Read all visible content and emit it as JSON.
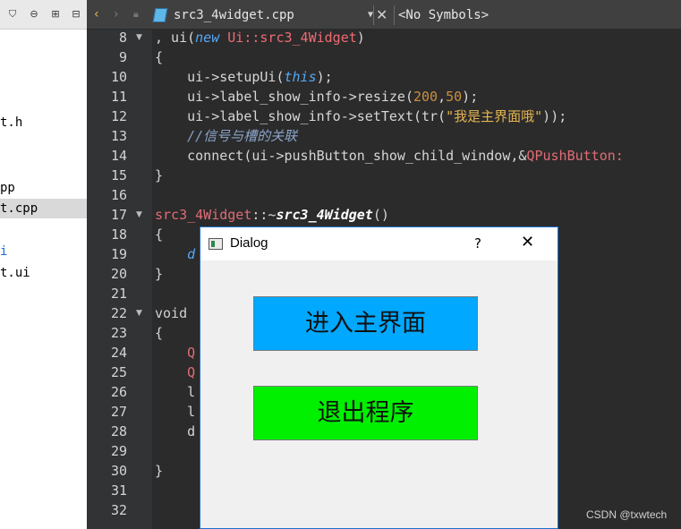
{
  "toolbar": {
    "file_name": "src3_4widget.cpp",
    "symbols": "<No Symbols>"
  },
  "tree": {
    "items": [
      {
        "label": "t.h",
        "selected": false,
        "blue": false
      },
      {
        "label": "pp",
        "selected": false,
        "blue": false
      },
      {
        "label": "t.cpp",
        "selected": true,
        "blue": false
      },
      {
        "label": "i",
        "selected": false,
        "blue": true
      },
      {
        "label": "t.ui",
        "selected": false,
        "blue": false
      }
    ]
  },
  "editor": {
    "line_numbers": [
      "8",
      "9",
      "10",
      "11",
      "12",
      "13",
      "14",
      "15",
      "16",
      "17",
      "18",
      "19",
      "20",
      "21",
      "22",
      "23",
      "24",
      "25",
      "26",
      "27",
      "28",
      "29",
      "30",
      "31",
      "32"
    ],
    "code": {
      "l8": ", ui(",
      "l8_new": "new",
      "l8_type": " Ui::src3_4Widget",
      "l8_end": ")",
      "l9": "{",
      "l10_a": "    ui->setupUi(",
      "l10_this": "this",
      "l10_b": ");",
      "l11_a": "    ui->label_show_info->resize(",
      "l11_n1": "200",
      "l11_c": ",",
      "l11_n2": "50",
      "l11_b": ");",
      "l12_a": "    ui->label_show_info->setText(tr(",
      "l12_str": "\"我是主界面哦\"",
      "l12_b": "));",
      "l13": "    //信号与槽的关联",
      "l14_a": "    connect(ui->pushButton_show_child_window,&",
      "l14_cls": "QPushButton:",
      "l15": "}",
      "l17_a": "src3_4Widget",
      "l17_b": "::~",
      "l17_fn": "src3_4Widget",
      "l17_c": "()",
      "l18": "{",
      "l19": "    d",
      "l20": "}",
      "l22": "void",
      "l23": "{",
      "l24": "    Q",
      "l25": "    Q",
      "l26": "    l",
      "l27": "    l",
      "l28": "    d",
      "l30": "}"
    }
  },
  "dialog": {
    "title": "Dialog",
    "help": "?",
    "close": "✕",
    "enter_button": "进入主界面",
    "exit_button": "退出程序",
    "colors": {
      "enter": "#00a8ff",
      "exit": "#00f000"
    }
  },
  "watermark": "CSDN @txwtech"
}
